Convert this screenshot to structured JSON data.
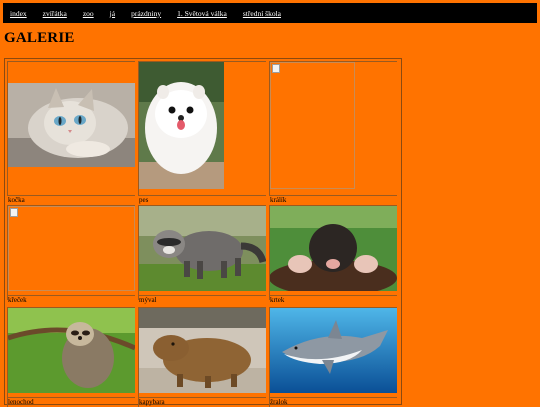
{
  "nav": {
    "items": [
      {
        "label": "index"
      },
      {
        "label": "zvířátka"
      },
      {
        "label": "zoo"
      },
      {
        "label": "já"
      },
      {
        "label": "prázdniny"
      },
      {
        "label": "1. Světová válka"
      },
      {
        "label": "střední škola"
      }
    ]
  },
  "heading": "GALERIE",
  "gallery": {
    "items": [
      {
        "caption": "kočka",
        "image": "cat-photo"
      },
      {
        "caption": "pes",
        "image": "pomeranian-photo"
      },
      {
        "caption": "králík",
        "image": "broken-image"
      },
      {
        "caption": "křeček",
        "image": "broken-image"
      },
      {
        "caption": "mýval",
        "image": "raccoon-photo"
      },
      {
        "caption": "krtek",
        "image": "mole-photo"
      },
      {
        "caption": "lenochod",
        "image": "sloth-photo"
      },
      {
        "caption": "kapybara",
        "image": "capybara-photo"
      },
      {
        "caption": "žralok",
        "image": "shark-photo"
      }
    ]
  },
  "colors": {
    "page_bg": "#ff7300",
    "navbar_bg": "#000000",
    "nav_link": "#ffffff"
  }
}
